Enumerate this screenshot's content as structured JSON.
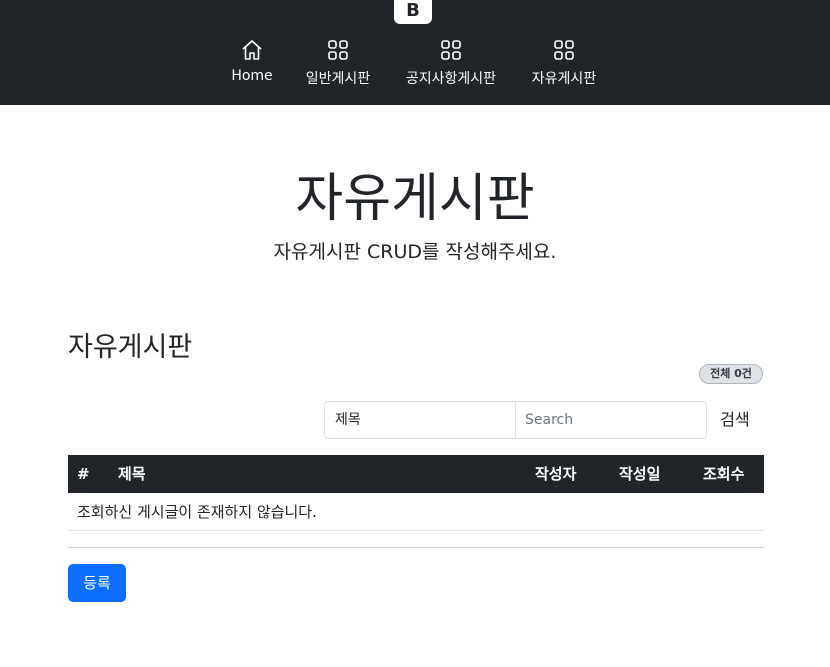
{
  "navbar": {
    "brand_letter": "B",
    "items": [
      {
        "label": "Home",
        "icon": "home-icon"
      },
      {
        "label": "일반게시판",
        "icon": "grid-icon"
      },
      {
        "label": "공지사항게시판",
        "icon": "grid-icon"
      },
      {
        "label": "자유게시판",
        "icon": "grid-icon"
      }
    ]
  },
  "hero": {
    "title": "자유게시판",
    "lead": "자유게시판 CRUD를 작성해주세요."
  },
  "board": {
    "title": "자유게시판",
    "total_badge": "전체 0건"
  },
  "search": {
    "field_selected": "제목",
    "placeholder": "Search",
    "button_label": "검색"
  },
  "table": {
    "headers": [
      "#",
      "제목",
      "작성자",
      "작성일",
      "조회수"
    ],
    "empty_message": "조회하신 게시글이 존재하지 않습니다."
  },
  "actions": {
    "register_label": "등록"
  },
  "colors": {
    "navbar_bg": "#212529",
    "primary": "#0d6efd",
    "badge_bg": "#dee2e6"
  }
}
